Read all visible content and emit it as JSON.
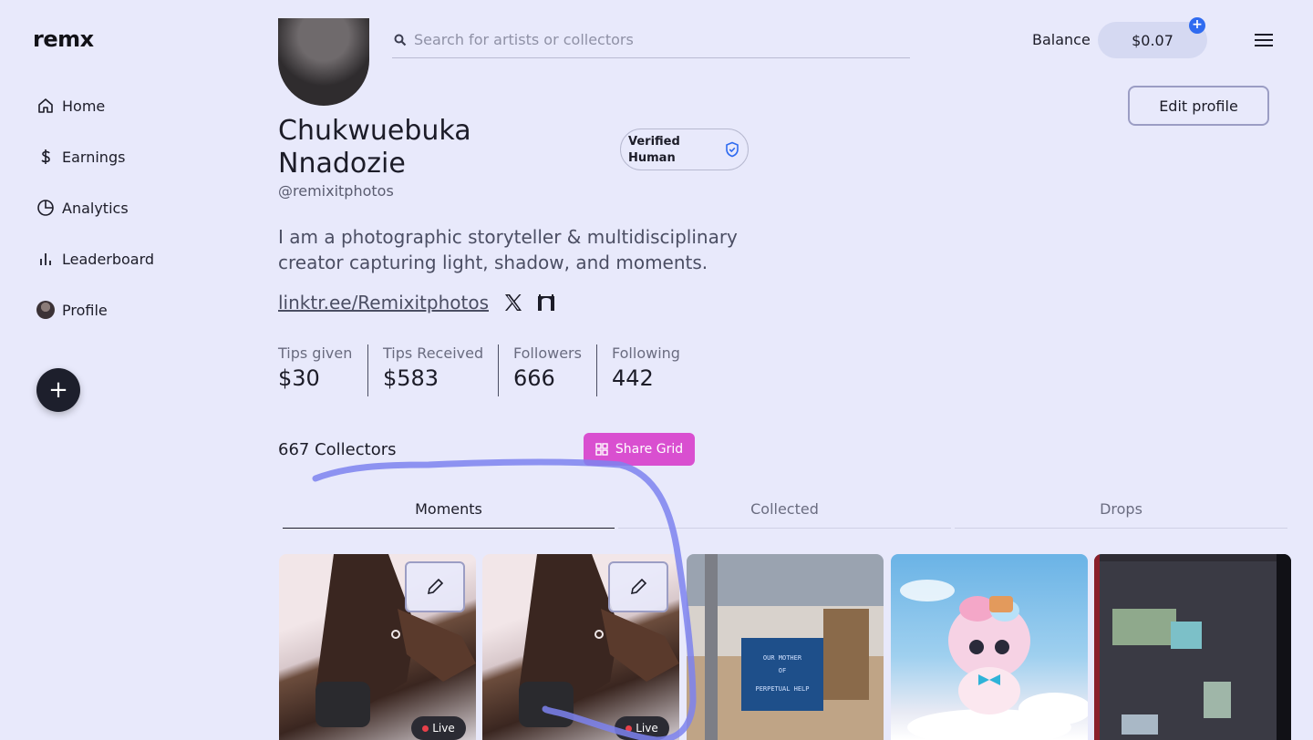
{
  "header": {
    "logo": "remx",
    "search_placeholder": "Search for artists or collectors",
    "balance_label": "Balance",
    "balance_value": "$0.07",
    "badge_plus": "+"
  },
  "sidebar": {
    "items": [
      {
        "label": "Home",
        "icon": "home-icon"
      },
      {
        "label": "Earnings",
        "icon": "dollar-icon"
      },
      {
        "label": "Analytics",
        "icon": "pie-chart-icon"
      },
      {
        "label": "Leaderboard",
        "icon": "bar-chart-icon"
      },
      {
        "label": "Profile",
        "icon": "avatar"
      }
    ],
    "fab": "+"
  },
  "profile": {
    "name": "Chukwuebuka Nnadozie",
    "handle": "@remixitphotos",
    "verified_label": "Verified Human",
    "edit_label": "Edit profile",
    "bio": "I am a photographic storyteller & multidisciplinary creator capturing light, shadow, and moments.",
    "link": "linktr.ee/Remixitphotos",
    "stats": [
      {
        "label": "Tips given",
        "value": "$30"
      },
      {
        "label": "Tips Received",
        "value": "$583"
      },
      {
        "label": "Followers",
        "value": "666"
      },
      {
        "label": "Following",
        "value": "442"
      }
    ],
    "collectors": "667 Collectors",
    "share_label": "Share Grid"
  },
  "tabs": [
    {
      "label": "Moments",
      "active": true
    },
    {
      "label": "Collected",
      "active": false
    },
    {
      "label": "Drops",
      "active": false
    }
  ],
  "grid": {
    "live_label": "Live",
    "box_text": [
      "OUR MOTHER",
      "OF",
      "PERPETUAL HELP"
    ]
  },
  "colors": {
    "background": "#e8e9fb",
    "accent_pink": "#d94fd0",
    "badge_blue": "#2f6bf0",
    "scribble": "#7d82ee"
  }
}
